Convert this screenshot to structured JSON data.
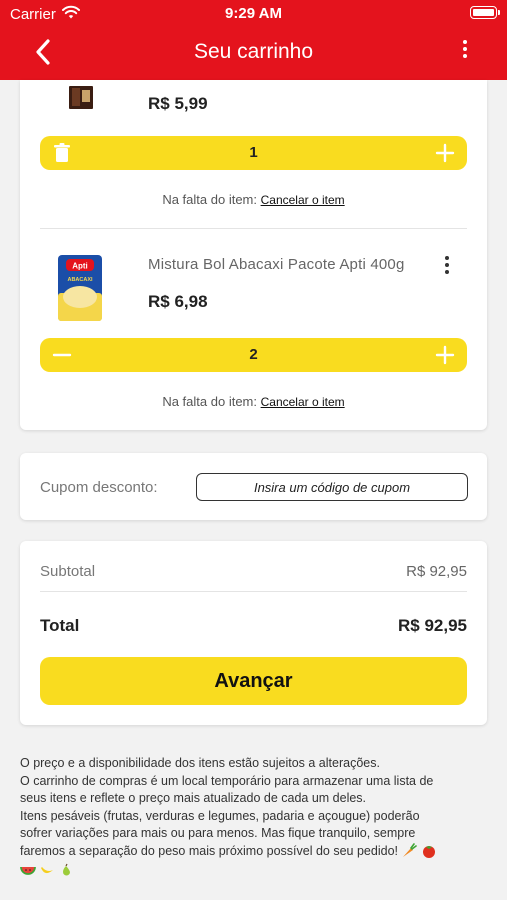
{
  "status_bar": {
    "carrier": "Carrier",
    "time": "9:29 AM"
  },
  "header": {
    "title": "Seu carrinho"
  },
  "cart": {
    "items": [
      {
        "price": "R$ 5,99",
        "quantity": "1",
        "missing_label": "Na falta do item:",
        "missing_action": "Cancelar o item"
      },
      {
        "name": "Mistura Bol Abacaxi Pacote Apti 400g",
        "price": "R$ 6,98",
        "quantity": "2",
        "missing_label": "Na falta do item:",
        "missing_action": "Cancelar o item",
        "package_brand": "Apti",
        "package_flavor": "ABACAXI"
      }
    ]
  },
  "coupon": {
    "label": "Cupom desconto:",
    "placeholder": "Insira um código de cupom"
  },
  "summary": {
    "subtotal_label": "Subtotal",
    "subtotal_value": "R$ 92,95",
    "total_label": "Total",
    "total_value": "R$ 92,95",
    "advance_label": "Avançar"
  },
  "disclaimer": {
    "line1": "O preço e a disponibilidade dos itens estão sujeitos a alterações.",
    "line2": "O carrinho de compras é um local temporário para armazenar uma lista de",
    "line3": "seus itens e reflete o preço mais atualizado de cada um deles.",
    "line4": "Itens pesáveis (frutas, verduras e legumes, padaria e açougue)  poderão",
    "line5": "sofrer variações para mais ou para menos. Mas fique tranquilo, sempre",
    "line6": "faremos a separação do peso mais próximo possível do seu pedido!"
  },
  "icons": {
    "back": "chevron-left-icon",
    "menu": "vertical-dots-icon",
    "trash": "trash-icon",
    "minus": "minus-icon",
    "plus": "plus-icon",
    "emojis": [
      "carrot",
      "tomato",
      "watermelon",
      "banana",
      "pear"
    ]
  },
  "colors": {
    "brand_red": "#e4131d",
    "accent_yellow": "#f9dc1f"
  }
}
